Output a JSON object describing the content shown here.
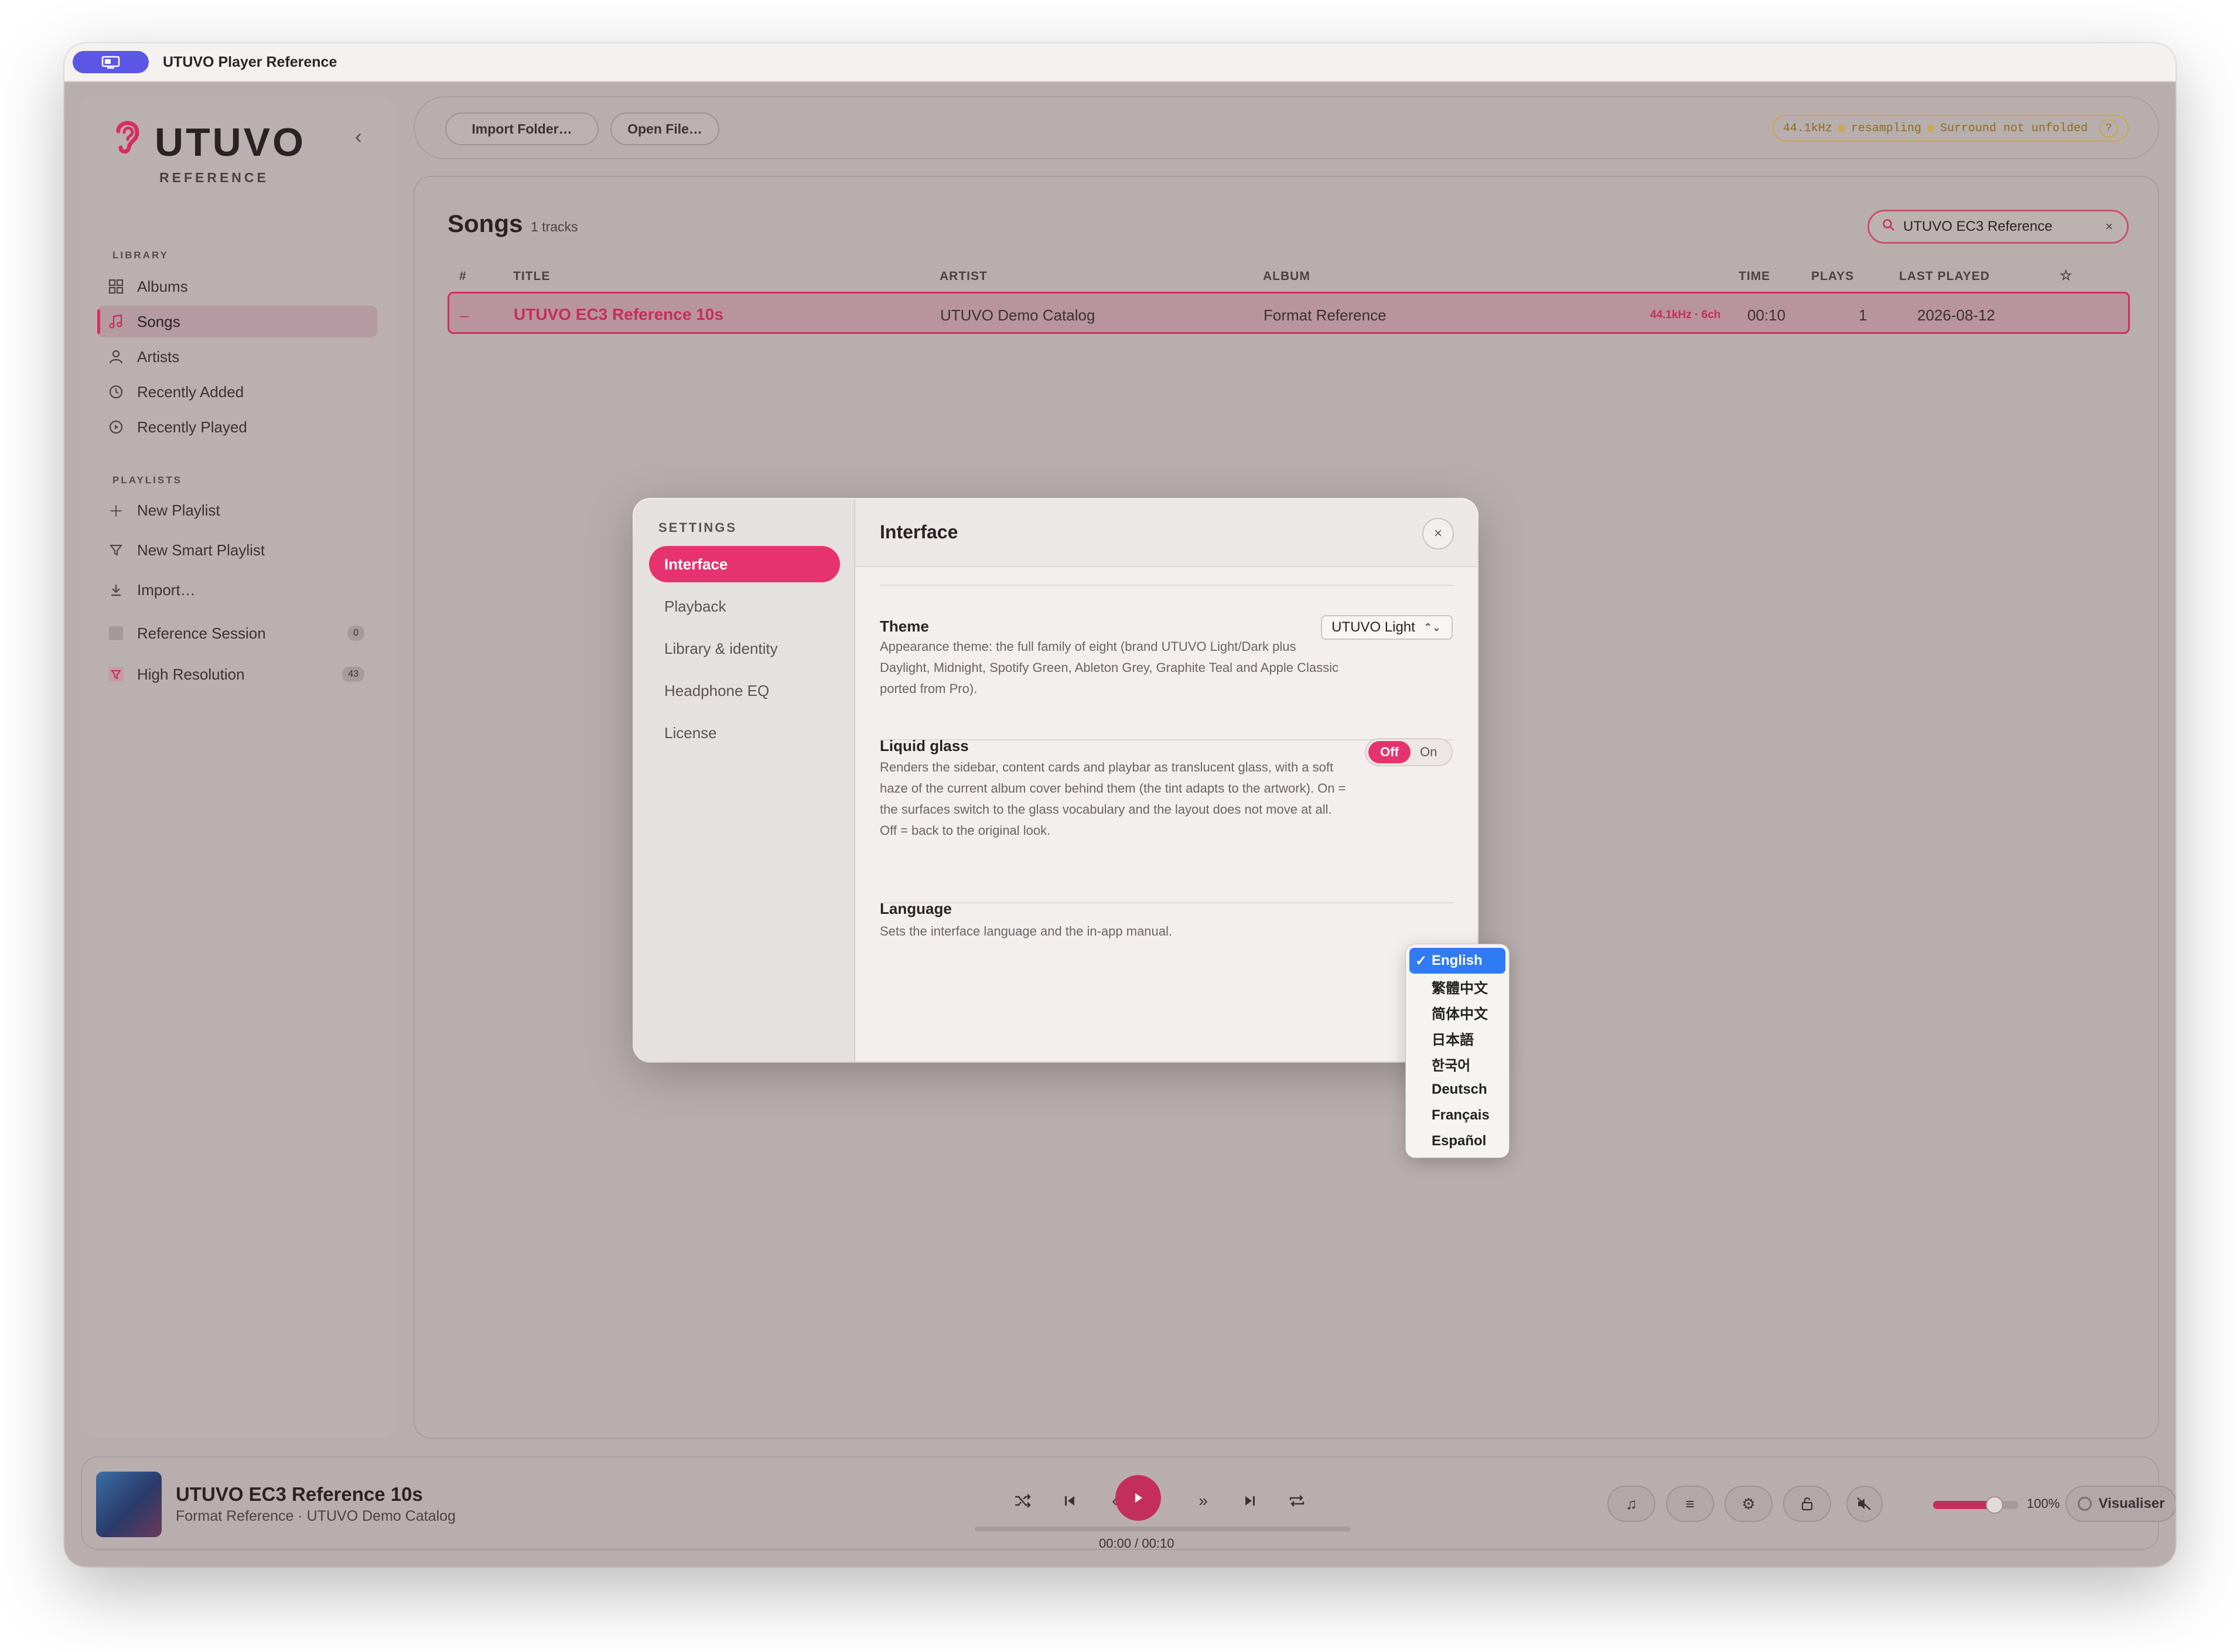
{
  "window": {
    "title": "UTUVO Player Reference"
  },
  "sidebar": {
    "logo": "UTUVO",
    "logo_sub": "REFERENCE",
    "library_label": "LIBRARY",
    "library": [
      "Albums",
      "Songs",
      "Artists",
      "Recently Added",
      "Recently Played"
    ],
    "playlists_label": "PLAYLISTS",
    "actions": [
      "New Playlist",
      "New Smart Playlist",
      "Import…"
    ],
    "playlists": [
      {
        "name": "Reference Session",
        "count": "0"
      },
      {
        "name": "High Resolution",
        "count": "43"
      }
    ]
  },
  "toolbar": {
    "import_folder": "Import Folder…",
    "open_file": "Open File…",
    "status": {
      "rate": "44.1kHz",
      "resampling": "resampling",
      "surround": "Surround not unfolded",
      "help": "?"
    }
  },
  "songs": {
    "title": "Songs",
    "count": "1 tracks",
    "search_value": "UTUVO EC3 Reference",
    "columns": [
      "#",
      "TITLE",
      "ARTIST",
      "ALBUM",
      "TIME",
      "PLAYS",
      "LAST PLAYED",
      "☆"
    ],
    "rows": [
      {
        "num": "–",
        "title": "UTUVO EC3 Reference 10s",
        "artist": "UTUVO Demo Catalog",
        "album": "Format Reference",
        "format": "44.1kHz · 6ch",
        "time": "00:10",
        "plays": "1",
        "last_played": "2026-08-12"
      }
    ]
  },
  "settings": {
    "label": "SETTINGS",
    "nav": [
      "Interface",
      "Playback",
      "Library & identity",
      "Headphone EQ",
      "License"
    ],
    "title": "Interface",
    "theme": {
      "name": "Theme",
      "desc": "Appearance theme: the full family of eight (brand UTUVO Light/Dark plus Daylight, Midnight, Spotify Green, Ableton Grey, Graphite Teal and Apple Classic ported from Pro).",
      "value": "UTUVO Light"
    },
    "glass": {
      "name": "Liquid glass",
      "desc": "Renders the sidebar, content cards and playbar as translucent glass, with a soft haze of the current album cover behind them (the tint adapts to the artwork). On = the surfaces switch to the glass vocabulary and the layout does not move at all. Off = back to the original look.",
      "off": "Off",
      "on": "On"
    },
    "language": {
      "name": "Language",
      "desc": "Sets the interface language and the in-app manual.",
      "options": [
        "English",
        "繁體中文",
        "简体中文",
        "日本語",
        "한국어",
        "Deutsch",
        "Français",
        "Español"
      ],
      "selected": "English"
    }
  },
  "player": {
    "title": "UTUVO EC3 Reference 10s",
    "subtitle": "Format Reference · UTUVO Demo Catalog",
    "time": "00:00 / 00:10",
    "progress": 0,
    "volume_label": "100%",
    "volume": 0.72,
    "visualiser": "Visualiser"
  },
  "colors": {
    "accent": "#e6336f",
    "selection": "#2f7bf2",
    "status": "#c9a94a"
  }
}
